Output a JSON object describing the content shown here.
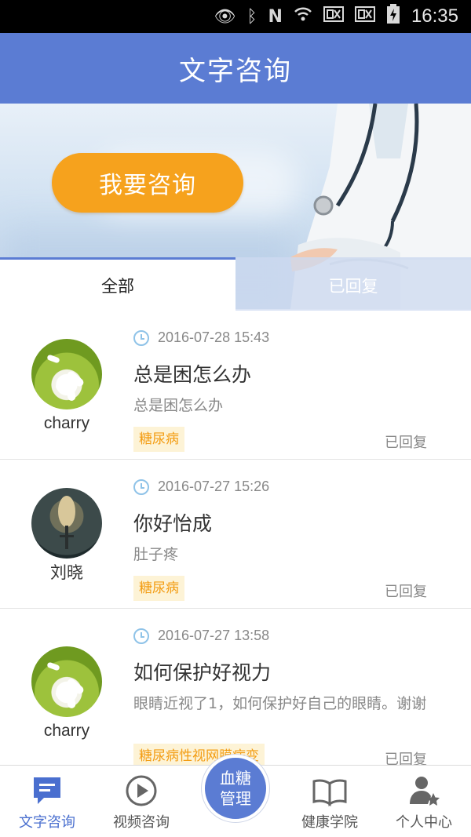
{
  "status_bar": {
    "icons": [
      "eye-icon",
      "bluetooth-icon",
      "nfc-icon",
      "wifi-icon",
      "sim-icon",
      "sim-icon",
      "battery-charging-icon"
    ],
    "time": "16:35"
  },
  "header": {
    "title": "文字咨询"
  },
  "banner": {
    "button_label": "我要咨询"
  },
  "tabs": [
    {
      "label": "全部",
      "active": true
    },
    {
      "label": "已回复",
      "active": false
    }
  ],
  "consultations": [
    {
      "username": "charry",
      "avatar": "daisy",
      "datetime": "2016-07-28 15:43",
      "title": "总是困怎么办",
      "body": "总是困怎么办",
      "tag": "糖尿病",
      "status": "已回复"
    },
    {
      "username": "刘晓",
      "avatar": "rocket",
      "datetime": "2016-07-27 15:26",
      "title": "你好怡成",
      "body": "肚子疼",
      "tag": "糖尿病",
      "status": "已回复"
    },
    {
      "username": "charry",
      "avatar": "daisy",
      "datetime": "2016-07-27 13:58",
      "title": "如何保护好视力",
      "body": "眼睛近视了1，如何保护好自己的眼睛。谢谢",
      "tag": "糖尿病性视网膜病变",
      "status": "已回复"
    }
  ],
  "bottom_nav": {
    "items": [
      {
        "label": "文字咨询",
        "icon": "chat-icon",
        "active": true
      },
      {
        "label": "视频咨询",
        "icon": "play-icon",
        "active": false
      },
      {
        "label": "健康学院",
        "icon": "book-icon",
        "active": false
      },
      {
        "label": "个人中心",
        "icon": "user-star-icon",
        "active": false
      }
    ],
    "center": {
      "line1": "血糖",
      "line2": "管理"
    }
  },
  "colors": {
    "primary": "#5b7cd3",
    "accent": "#f6a21d",
    "tag_text": "#f39c12",
    "tag_bg": "#fdf3d6"
  }
}
